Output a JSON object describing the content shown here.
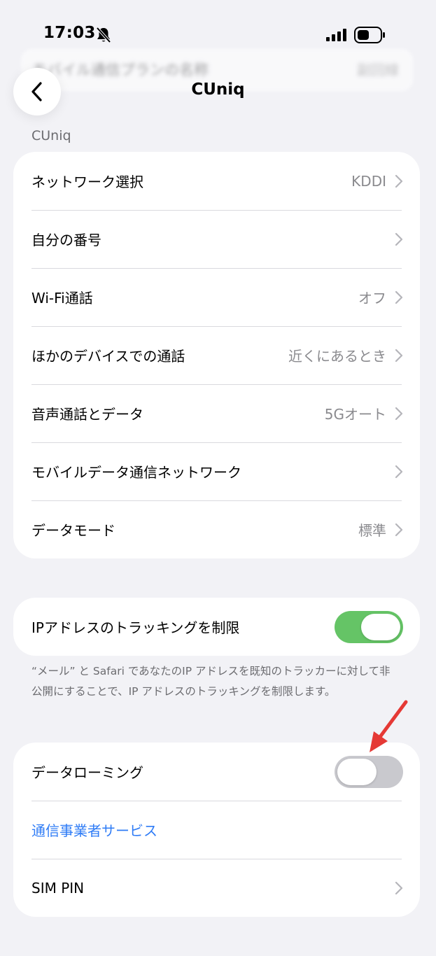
{
  "status_bar": {
    "time": "17:03",
    "icons": [
      "bell-slash-icon",
      "cellular-signal-icon",
      "battery-icon"
    ]
  },
  "background_row": {
    "label": "モバイル通信プランの名称",
    "value": "副回線"
  },
  "nav": {
    "title": "CUniq",
    "back_icon": "chevron-left-icon"
  },
  "section": {
    "header": "CUniq"
  },
  "group1": {
    "rows": [
      {
        "label": "ネットワーク選択",
        "value": "KDDI"
      },
      {
        "label": "自分の番号",
        "value": ""
      },
      {
        "label": "Wi-Fi通話",
        "value": "オフ"
      },
      {
        "label": "ほかのデバイスでの通話",
        "value": "近くにあるとき"
      },
      {
        "label": "音声通話とデータ",
        "value": "5Gオート"
      },
      {
        "label": "モバイルデータ通信ネットワーク",
        "value": ""
      },
      {
        "label": "データモード",
        "value": "標準"
      }
    ]
  },
  "group2": {
    "ip_tracking": {
      "label": "IPアドレスのトラッキングを制限",
      "enabled": true
    },
    "footnote": "“メール” と Safari であなたのIP アドレスを既知のトラッカーに対して非公開にすることで、IP アドレスのトラッキングを制限します。"
  },
  "group3": {
    "data_roaming": {
      "label": "データローミング",
      "enabled": false
    },
    "carrier_services": {
      "label": "通信事業者サービス"
    },
    "sim_pin": {
      "label": "SIM PIN"
    }
  },
  "colors": {
    "background": "#f2f2f6",
    "toggle_on": "#65c466",
    "toggle_off": "#c9c9ce",
    "link": "#2f7cf6",
    "annotation_arrow": "#e53935"
  }
}
